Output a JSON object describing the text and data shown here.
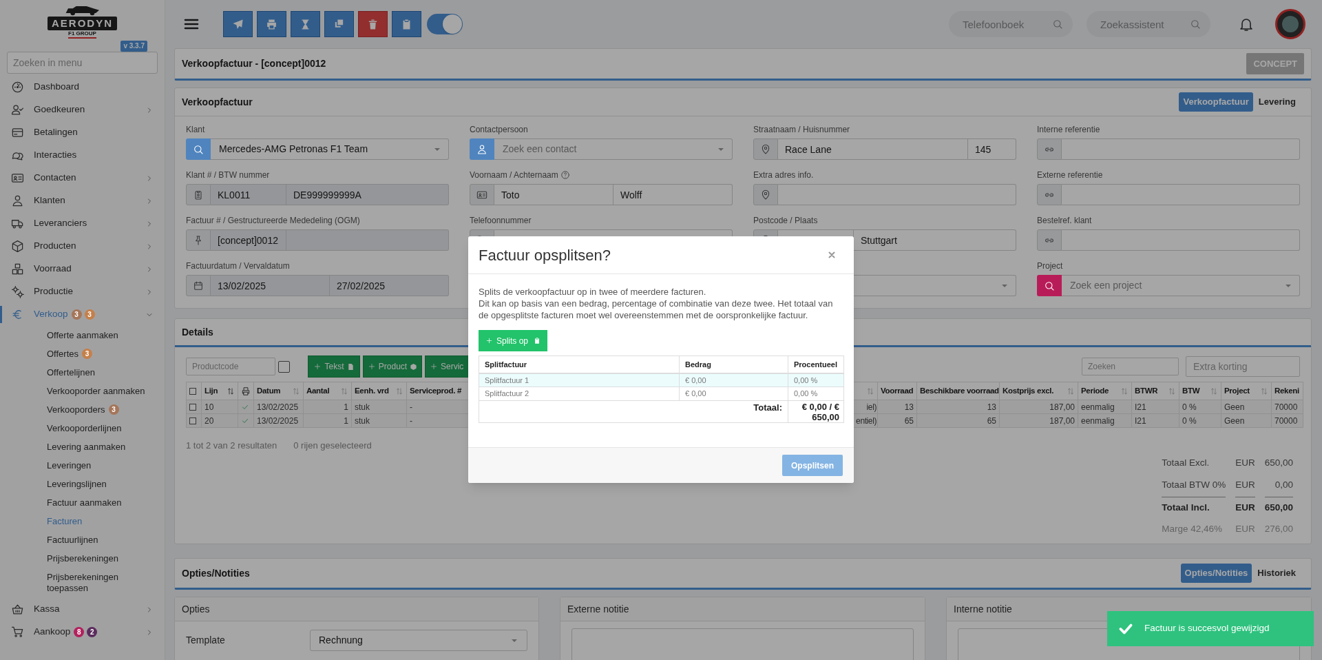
{
  "sidebar": {
    "logo": {
      "text": "AERODYN",
      "subtext": "F1 GROUP"
    },
    "version": "v 3.3.7",
    "search_placeholder": "Zoeken in menu",
    "items": [
      {
        "label": "Dashboard",
        "selected": false
      },
      {
        "label": "Goedkeuren",
        "selected": false,
        "expanded": false
      },
      {
        "label": "Betalingen",
        "selected": false
      },
      {
        "label": "Interacties",
        "selected": false
      },
      {
        "label": "Contacten",
        "selected": false,
        "expanded": false
      },
      {
        "label": "Klanten",
        "selected": false,
        "expanded": false
      },
      {
        "label": "Leveranciers",
        "selected": false,
        "expanded": false
      },
      {
        "label": "Producten",
        "selected": false,
        "expanded": false
      },
      {
        "label": "Voorraad",
        "selected": false,
        "expanded": false
      },
      {
        "label": "Productie",
        "selected": false,
        "expanded": false
      },
      {
        "label": "Verkoop",
        "selected": true,
        "expanded": true,
        "badges": [
          {
            "text": "3",
            "color": "#a5765a"
          },
          {
            "text": "3",
            "color": "#c5804a"
          }
        ],
        "children": [
          {
            "label": "Offerte aanmaken",
            "selected": false
          },
          {
            "label": "Offertes",
            "selected": false,
            "badges": [
              {
                "text": "3",
                "color": "#c5804a"
              }
            ]
          },
          {
            "label": "Offertelijnen",
            "selected": false
          },
          {
            "label": "Verkooporder aanmaken",
            "selected": false
          },
          {
            "label": "Verkooporders",
            "selected": false,
            "badges": [
              {
                "text": "3",
                "color": "#a5765a"
              }
            ]
          },
          {
            "label": "Verkooporderlijnen",
            "selected": false
          },
          {
            "label": "Levering aanmaken",
            "selected": false
          },
          {
            "label": "Leveringen",
            "selected": false
          },
          {
            "label": "Leveringslijnen",
            "selected": false
          },
          {
            "label": "Factuur aanmaken",
            "selected": false
          },
          {
            "label": "Facturen",
            "selected": true
          },
          {
            "label": "Factuurlijnen",
            "selected": false
          },
          {
            "label": "Prijsberekeningen",
            "selected": false
          },
          {
            "label": "Prijsberekeningen toepassen",
            "selected": false
          }
        ]
      },
      {
        "label": "Kassa",
        "selected": false,
        "expanded": false
      },
      {
        "label": "Aankoop",
        "selected": false,
        "expanded": false,
        "badges": [
          {
            "text": "8",
            "color": "#b2225e"
          },
          {
            "text": "2",
            "color": "#5c2c5e"
          }
        ]
      }
    ]
  },
  "topbar": {
    "toolbar_buttons": [
      {
        "kind": "primary"
      },
      {
        "kind": "primary"
      },
      {
        "kind": "primary"
      },
      {
        "kind": "primary"
      },
      {
        "kind": "danger"
      },
      {
        "kind": "primary"
      }
    ],
    "toggle": {
      "on": true
    },
    "searches": [
      {
        "placeholder": "Telefoonboek"
      },
      {
        "placeholder": "Zoekassistent"
      }
    ]
  },
  "header": {
    "title": "Verkoopfactuur - [concept]0012",
    "status": "CONCEPT"
  },
  "invoice": {
    "title": "Verkoopfactuur",
    "tabs": [
      {
        "label": "Verkoopfactuur",
        "selected": true
      },
      {
        "label": "Levering",
        "selected": false
      }
    ],
    "fields": [
      {
        "kind": "select",
        "label": "Klant",
        "value": "Mercedes-AMG Petronas F1 Team",
        "color": "#4f84be"
      },
      {
        "kind": "select",
        "label": "Contactpersoon",
        "placeholder": "Zoek een contact",
        "color": "#4f84be"
      },
      {
        "kind": "wide-narrow",
        "label": "Straatnaam / Huisnummer",
        "value": "Race Lane",
        "value_2": "145",
        "readonly": false
      },
      {
        "kind": "single",
        "label": "Interne referentie",
        "readonly": false
      },
      {
        "kind": "narrow-wide",
        "label": "Klant # / BTW nummer",
        "value": "KL0011",
        "value_2": "DE999999999A",
        "readonly": true
      },
      {
        "kind": "pair",
        "label": "Voornaam / Achternaam",
        "help": true,
        "value": "Toto",
        "value_2": "Wolff",
        "readonly": false
      },
      {
        "kind": "single",
        "label": "Extra adres info.",
        "readonly": false
      },
      {
        "kind": "single",
        "label": "Externe referentie",
        "readonly": false
      },
      {
        "kind": "narrow-wide",
        "label": "Factuur # / Gestructureerde Mededeling (OGM)",
        "value": "[concept]0012",
        "readonly": true
      },
      {
        "kind": "single",
        "label": "Telefoonnummer",
        "readonly": false
      },
      {
        "kind": "narrow-wide",
        "label": "Postcode / Plaats",
        "value_2": "Stuttgart",
        "readonly": false
      },
      {
        "kind": "single",
        "label": "Bestelref. klant",
        "readonly": false
      },
      {
        "kind": "pair",
        "label": "Factuurdatum / Vervaldatum",
        "value": "13/02/2025",
        "value_2": "27/02/2025",
        "readonly": true
      },
      {
        "kind": "select"
      },
      {
        "kind": "select"
      },
      {
        "kind": "select",
        "label": "Project",
        "placeholder": "Zoek een project",
        "color": "#b81c58"
      }
    ]
  },
  "details": {
    "title": "Details",
    "productcode_placeholder": "Productcode",
    "productcode_toggle": {
      "checked": false
    },
    "buttons": [
      {
        "label": "Tekst"
      },
      {
        "label": "Product"
      },
      {
        "label": "Servic"
      }
    ],
    "search_placeholder": "Zoeken",
    "discount_placeholder": "Extra korting",
    "columns": [
      {
        "kind": "checkbox",
        "checked": false
      },
      {
        "kind": "text",
        "label": "Lijn",
        "sorted": true
      },
      {
        "kind": "print"
      },
      {
        "kind": "text",
        "label": "Datum",
        "sorted": false
      },
      {
        "kind": "number",
        "label": "Aantal",
        "sorted": false
      },
      {
        "kind": "text",
        "label": "Eenh. vrd",
        "sorted": false
      },
      {
        "kind": "text",
        "label": "Serviceprod. #"
      },
      {
        "kind": "number",
        "sorted": false
      },
      {
        "kind": "number",
        "label": "Voorraad"
      },
      {
        "kind": "number",
        "label": "Beschikbare voorraad"
      },
      {
        "kind": "number",
        "label": "Kostprijs excl.",
        "sorted": false
      },
      {
        "kind": "text",
        "label": "Periode",
        "sorted": false
      },
      {
        "kind": "text",
        "label": "BTWR",
        "sorted": false
      },
      {
        "kind": "text",
        "label": "BTW",
        "sorted": false
      },
      {
        "kind": "text",
        "label": "Project",
        "sorted": false
      },
      {
        "kind": "text",
        "label": "Rekeni"
      }
    ],
    "rows": [
      {
        "selected": false,
        "printed": true,
        "cells": [
          "",
          "10",
          "",
          "13/02/2025",
          "1",
          "stuk",
          "-",
          "iel)",
          "13",
          "13",
          "187,00",
          "eenmalig",
          "I21",
          "0 %",
          "Geen",
          "70000"
        ]
      },
      {
        "selected": false,
        "printed": true,
        "cells": [
          "",
          "20",
          "",
          "13/02/2025",
          "1",
          "stuk",
          "-",
          "entiel)",
          "65",
          "65",
          "187,00",
          "eenmalig",
          "I21",
          "0 %",
          "Geen",
          "70000"
        ]
      }
    ],
    "result_count": "1 tot 2 van 2 resultaten",
    "selection_count": "0 rijen geselecteerd",
    "totals": [
      {
        "kind": "normal",
        "label": "Totaal Excl.",
        "currency": "EUR",
        "amount": "650,00"
      },
      {
        "kind": "normal",
        "label": "Totaal BTW 0%",
        "currency": "EUR",
        "amount": "0,00"
      },
      {
        "kind": "total",
        "label": "Totaal Incl.",
        "currency": "EUR",
        "amount": "650,00"
      },
      {
        "kind": "muted",
        "label": "Marge 42,46%",
        "currency": "EUR",
        "amount": "276,00"
      }
    ]
  },
  "notes": {
    "title": "Opties/Notities",
    "tabs": [
      {
        "label": "Opties/Notities",
        "selected": true
      },
      {
        "label": "Historiek",
        "selected": false
      }
    ],
    "options": {
      "title": "Opties",
      "template_label": "Template",
      "template_value": "Rechnung"
    },
    "external_note": {
      "title": "Externe notitie"
    },
    "internal_note": {
      "title": "Interne notitie"
    }
  },
  "modal": {
    "title": "Factuur opsplitsen?",
    "description": [
      "Splits de verkoopfactuur op in twee of meerdere facturen.",
      "Dit kan op basis van een bedrag, percentage of combinatie van deze twee. Het totaal van de opgesplitste facturen moet wel overeenstemmen met de oorspronkelijke factuur."
    ],
    "add_button": "Splits op",
    "columns": [
      "Splitfactuur",
      "Bedrag",
      "Procentueel"
    ],
    "rows": [
      {
        "name": "Splitfactuur 1",
        "amount": "€ 0,00",
        "percent": "0,00 %",
        "selected": true
      },
      {
        "name": "Splitfactuur 2",
        "amount": "€ 0,00",
        "percent": "0,00 %",
        "selected": false
      }
    ],
    "total_label": "Totaal:",
    "total_value": "€ 0,00 / € 650,00",
    "confirm_button": {
      "label": "Opsplitsen",
      "disabled": true
    }
  },
  "toast": {
    "message": "Factuur is succesvol gewijzigd"
  }
}
